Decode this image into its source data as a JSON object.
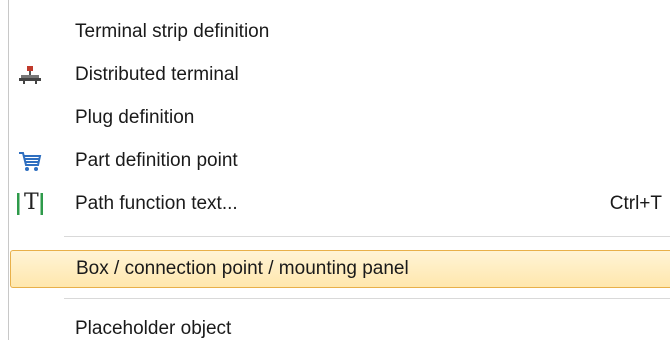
{
  "menu": {
    "items": [
      {
        "label": "Terminal strip definition",
        "icon": "",
        "shortcut": ""
      },
      {
        "label": "Distributed terminal",
        "icon": "distributed-terminal-icon",
        "shortcut": ""
      },
      {
        "label": "Plug definition",
        "icon": "",
        "shortcut": ""
      },
      {
        "label": "Part definition point",
        "icon": "shopping-cart-icon",
        "shortcut": ""
      },
      {
        "label": "Path function text...",
        "icon": "text-frame-icon",
        "shortcut": "Ctrl+T"
      },
      {
        "label": "Box / connection point / mounting panel",
        "icon": "",
        "shortcut": ""
      },
      {
        "label": "Placeholder object",
        "icon": "",
        "shortcut": ""
      }
    ],
    "highlighted_index": 5,
    "text_icon_glyph": "T",
    "colors": {
      "highlight_fill": "#ffe7ad",
      "highlight_border": "#e8b04a",
      "cart_icon": "#2f6fc0",
      "terminal_icon": "#c0392b"
    }
  }
}
